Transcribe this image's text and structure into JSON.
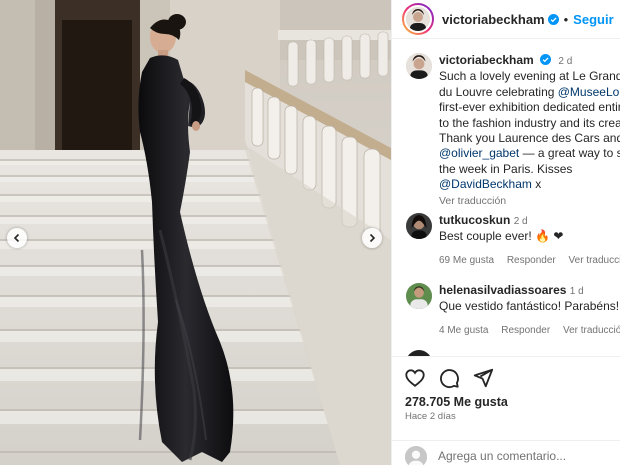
{
  "header": {
    "username": "victoriabeckham",
    "follow_label": "Seguir",
    "separator": "•"
  },
  "post": {
    "username": "victoriabeckham",
    "time": "2 d",
    "caption": {
      "line1": "Such a lovely evening at Le Grand D",
      "line2_pre": "du Louvre celebrating ",
      "line2_mention": "@MuseeLouv",
      "line3": "first-ever exhibition dedicated entire",
      "line4": "to the fashion industry and its creati",
      "line5": "Thank you Laurence des Cars and",
      "line6_mention": "@olivier_gabet",
      "line6_post": " — a great way to sta",
      "line7": "the week in Paris. Kisses",
      "line8_mention": "@DavidBeckham",
      "line8_post": " x"
    },
    "see_translation": "Ver traducción"
  },
  "comments": [
    {
      "username": "tutkucoskun",
      "time": "2 d",
      "text": "Best couple ever! 🔥 ❤",
      "likes": "69 Me gusta",
      "reply": "Responder",
      "translate": "Ver traducción"
    },
    {
      "username": "helenasilvadiassoares",
      "time": "1 d",
      "text": "Que vestido fantástico! Parabéns!",
      "likes": "4 Me gusta",
      "reply": "Responder",
      "translate": "Ver traducción"
    }
  ],
  "footer": {
    "likes": "278.705 Me gusta",
    "ago": "Hace 2 días",
    "comment_placeholder": "Agrega un comentario..."
  },
  "colors": {
    "accent": "#0095f6",
    "verified": "#0095f6",
    "heart": "#ed4956"
  }
}
